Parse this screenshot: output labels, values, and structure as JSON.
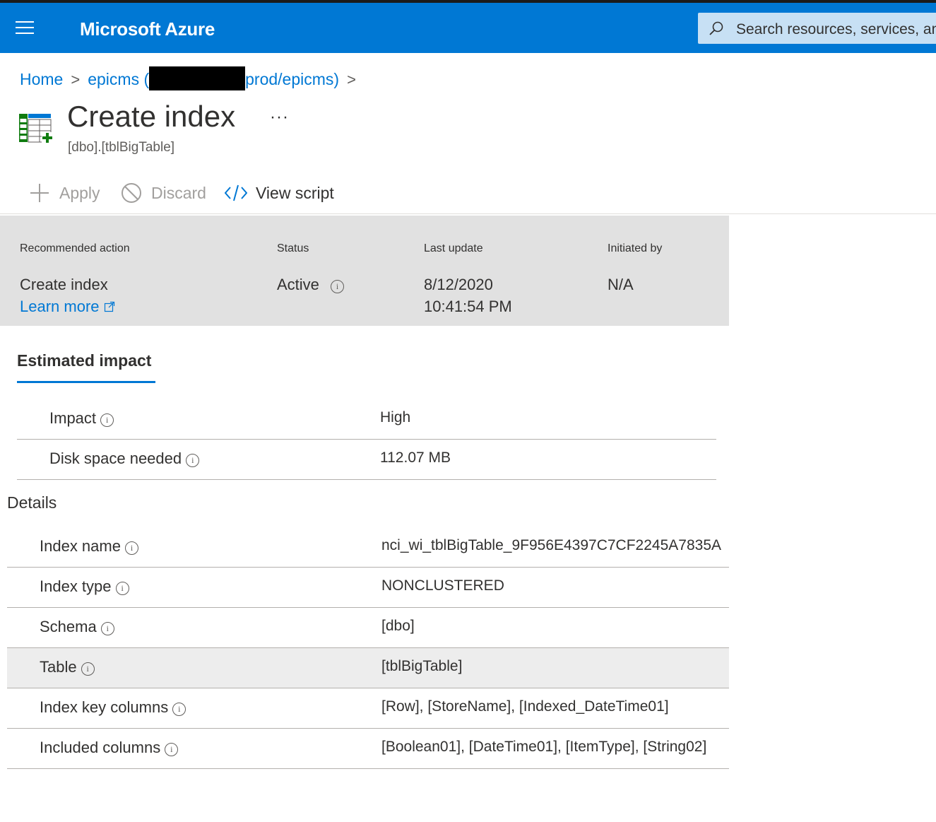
{
  "header": {
    "brand": "Microsoft Azure",
    "search_placeholder": "Search resources, services, and docs"
  },
  "breadcrumb": {
    "home": "Home",
    "resource_prefix": "epicms (",
    "resource_suffix": "prod/epicms)"
  },
  "page": {
    "title": "Create index",
    "more": "···",
    "subtitle": "[dbo].[tblBigTable]"
  },
  "toolbar": {
    "apply": "Apply",
    "discard": "Discard",
    "view_script": "View script"
  },
  "recommendation": {
    "headers": {
      "action": "Recommended action",
      "status": "Status",
      "last_update": "Last update",
      "initiated_by": "Initiated by"
    },
    "action": "Create index",
    "learn_more": "Learn more",
    "status": "Active",
    "last_update_date": "8/12/2020",
    "last_update_time": "10:41:54 PM",
    "initiated_by": "N/A"
  },
  "impact": {
    "tab_label": "Estimated impact",
    "rows": [
      {
        "label": "Impact",
        "value": "High"
      },
      {
        "label": "Disk space needed",
        "value": "112.07 MB"
      }
    ]
  },
  "details": {
    "heading": "Details",
    "rows": [
      {
        "label": "Index name",
        "value": "nci_wi_tblBigTable_9F956E4397C7CF2245A7835A"
      },
      {
        "label": "Index type",
        "value": "NONCLUSTERED"
      },
      {
        "label": "Schema",
        "value": "[dbo]"
      },
      {
        "label": "Table",
        "value": "[tblBigTable]"
      },
      {
        "label": "Index key columns",
        "value": "[Row], [StoreName], [Indexed_DateTime01]"
      },
      {
        "label": "Included columns",
        "value": "[Boolean01], [DateTime01], [ItemType], [String02]"
      }
    ]
  },
  "icons": {
    "menu": "hamburger-menu-icon",
    "search": "search-icon",
    "table_add": "table-add-icon",
    "plus": "plus-icon",
    "discard": "circle-slash-icon",
    "code": "code-icon",
    "info": "info-icon",
    "external": "external-link-icon"
  },
  "colors": {
    "brand": "#0078d4",
    "search_bg": "#c7e0f4",
    "recommendation_bg": "#e1e1e1",
    "icon_green": "#107c10"
  }
}
